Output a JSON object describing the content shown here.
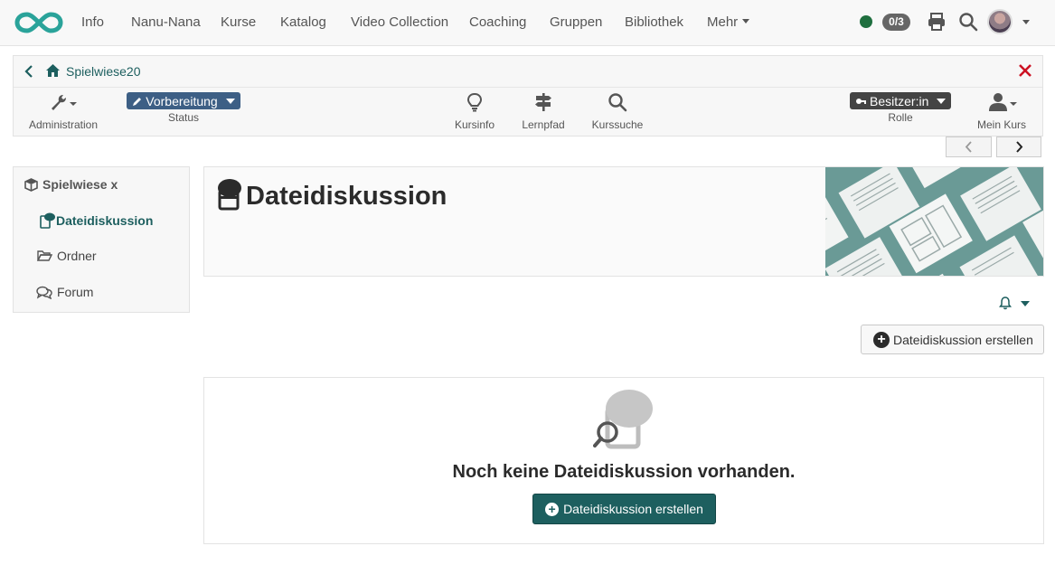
{
  "topnav": {
    "logo": "infinity-logo-icon",
    "items": [
      "Info",
      "Nanu-Nana",
      "Kurse",
      "Katalog",
      "Video Collection",
      "Coaching",
      "Gruppen",
      "Bibliothek",
      "Mehr"
    ],
    "badge": "0/3",
    "icons": [
      "printer-icon",
      "search-icon"
    ],
    "status_color": "#1f6f3f"
  },
  "course": {
    "title": "Spielwiese20",
    "tools": {
      "administration": "Administration",
      "status_value": "Vorbereitung",
      "status_label": "Status",
      "kursinfo": "Kursinfo",
      "lernpfad": "Lernpfad",
      "kurssuche": "Kurssuche",
      "rolle_value": "Besitzer:in",
      "rolle_label": "Rolle",
      "mein_kurs": "Mein Kurs"
    },
    "accent": "#1d5f5f",
    "close_color": "#cc1122"
  },
  "leftmenu": {
    "root": "Spielwiese x",
    "items": [
      {
        "label": "Dateidiskussion",
        "icon": "file-discussion-icon",
        "active": true
      },
      {
        "label": "Ordner",
        "icon": "folder-icon",
        "active": false
      },
      {
        "label": "Forum",
        "icon": "forum-icon",
        "active": false
      }
    ]
  },
  "main": {
    "title": "Dateidiskussion",
    "create_button": "Dateidiskussion erstellen",
    "empty_message": "Noch keine Dateidiskussion vorhanden.",
    "empty_button": "Dateidiskussion erstellen"
  }
}
